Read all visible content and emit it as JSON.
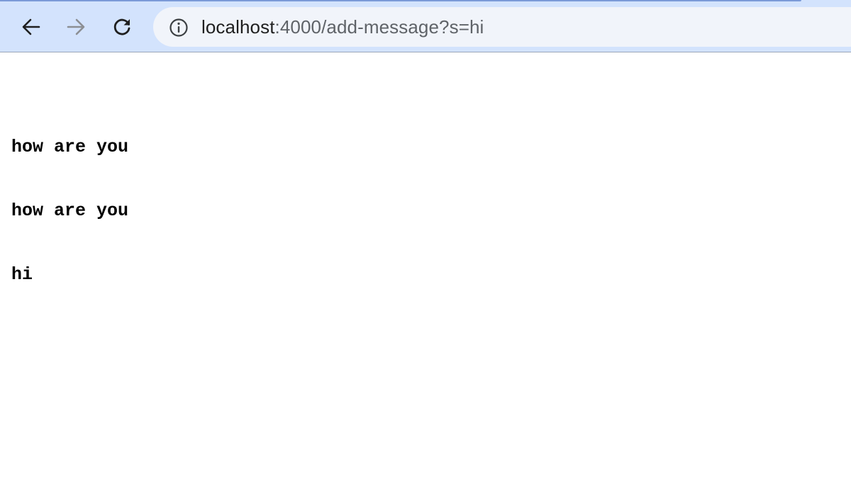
{
  "browser": {
    "url": {
      "host": "localhost",
      "rest": ":4000/add-message?s=hi"
    },
    "icons": {
      "back": "arrow-left-icon",
      "forward": "arrow-right-icon",
      "reload": "reload-icon",
      "site_info": "info-circle-icon"
    },
    "colors": {
      "toolbar_bg": "#d3e3fd",
      "omnibox_bg": "#f1f4fa"
    }
  },
  "page": {
    "messages": [
      "how are you",
      "how are you",
      "hi"
    ]
  }
}
